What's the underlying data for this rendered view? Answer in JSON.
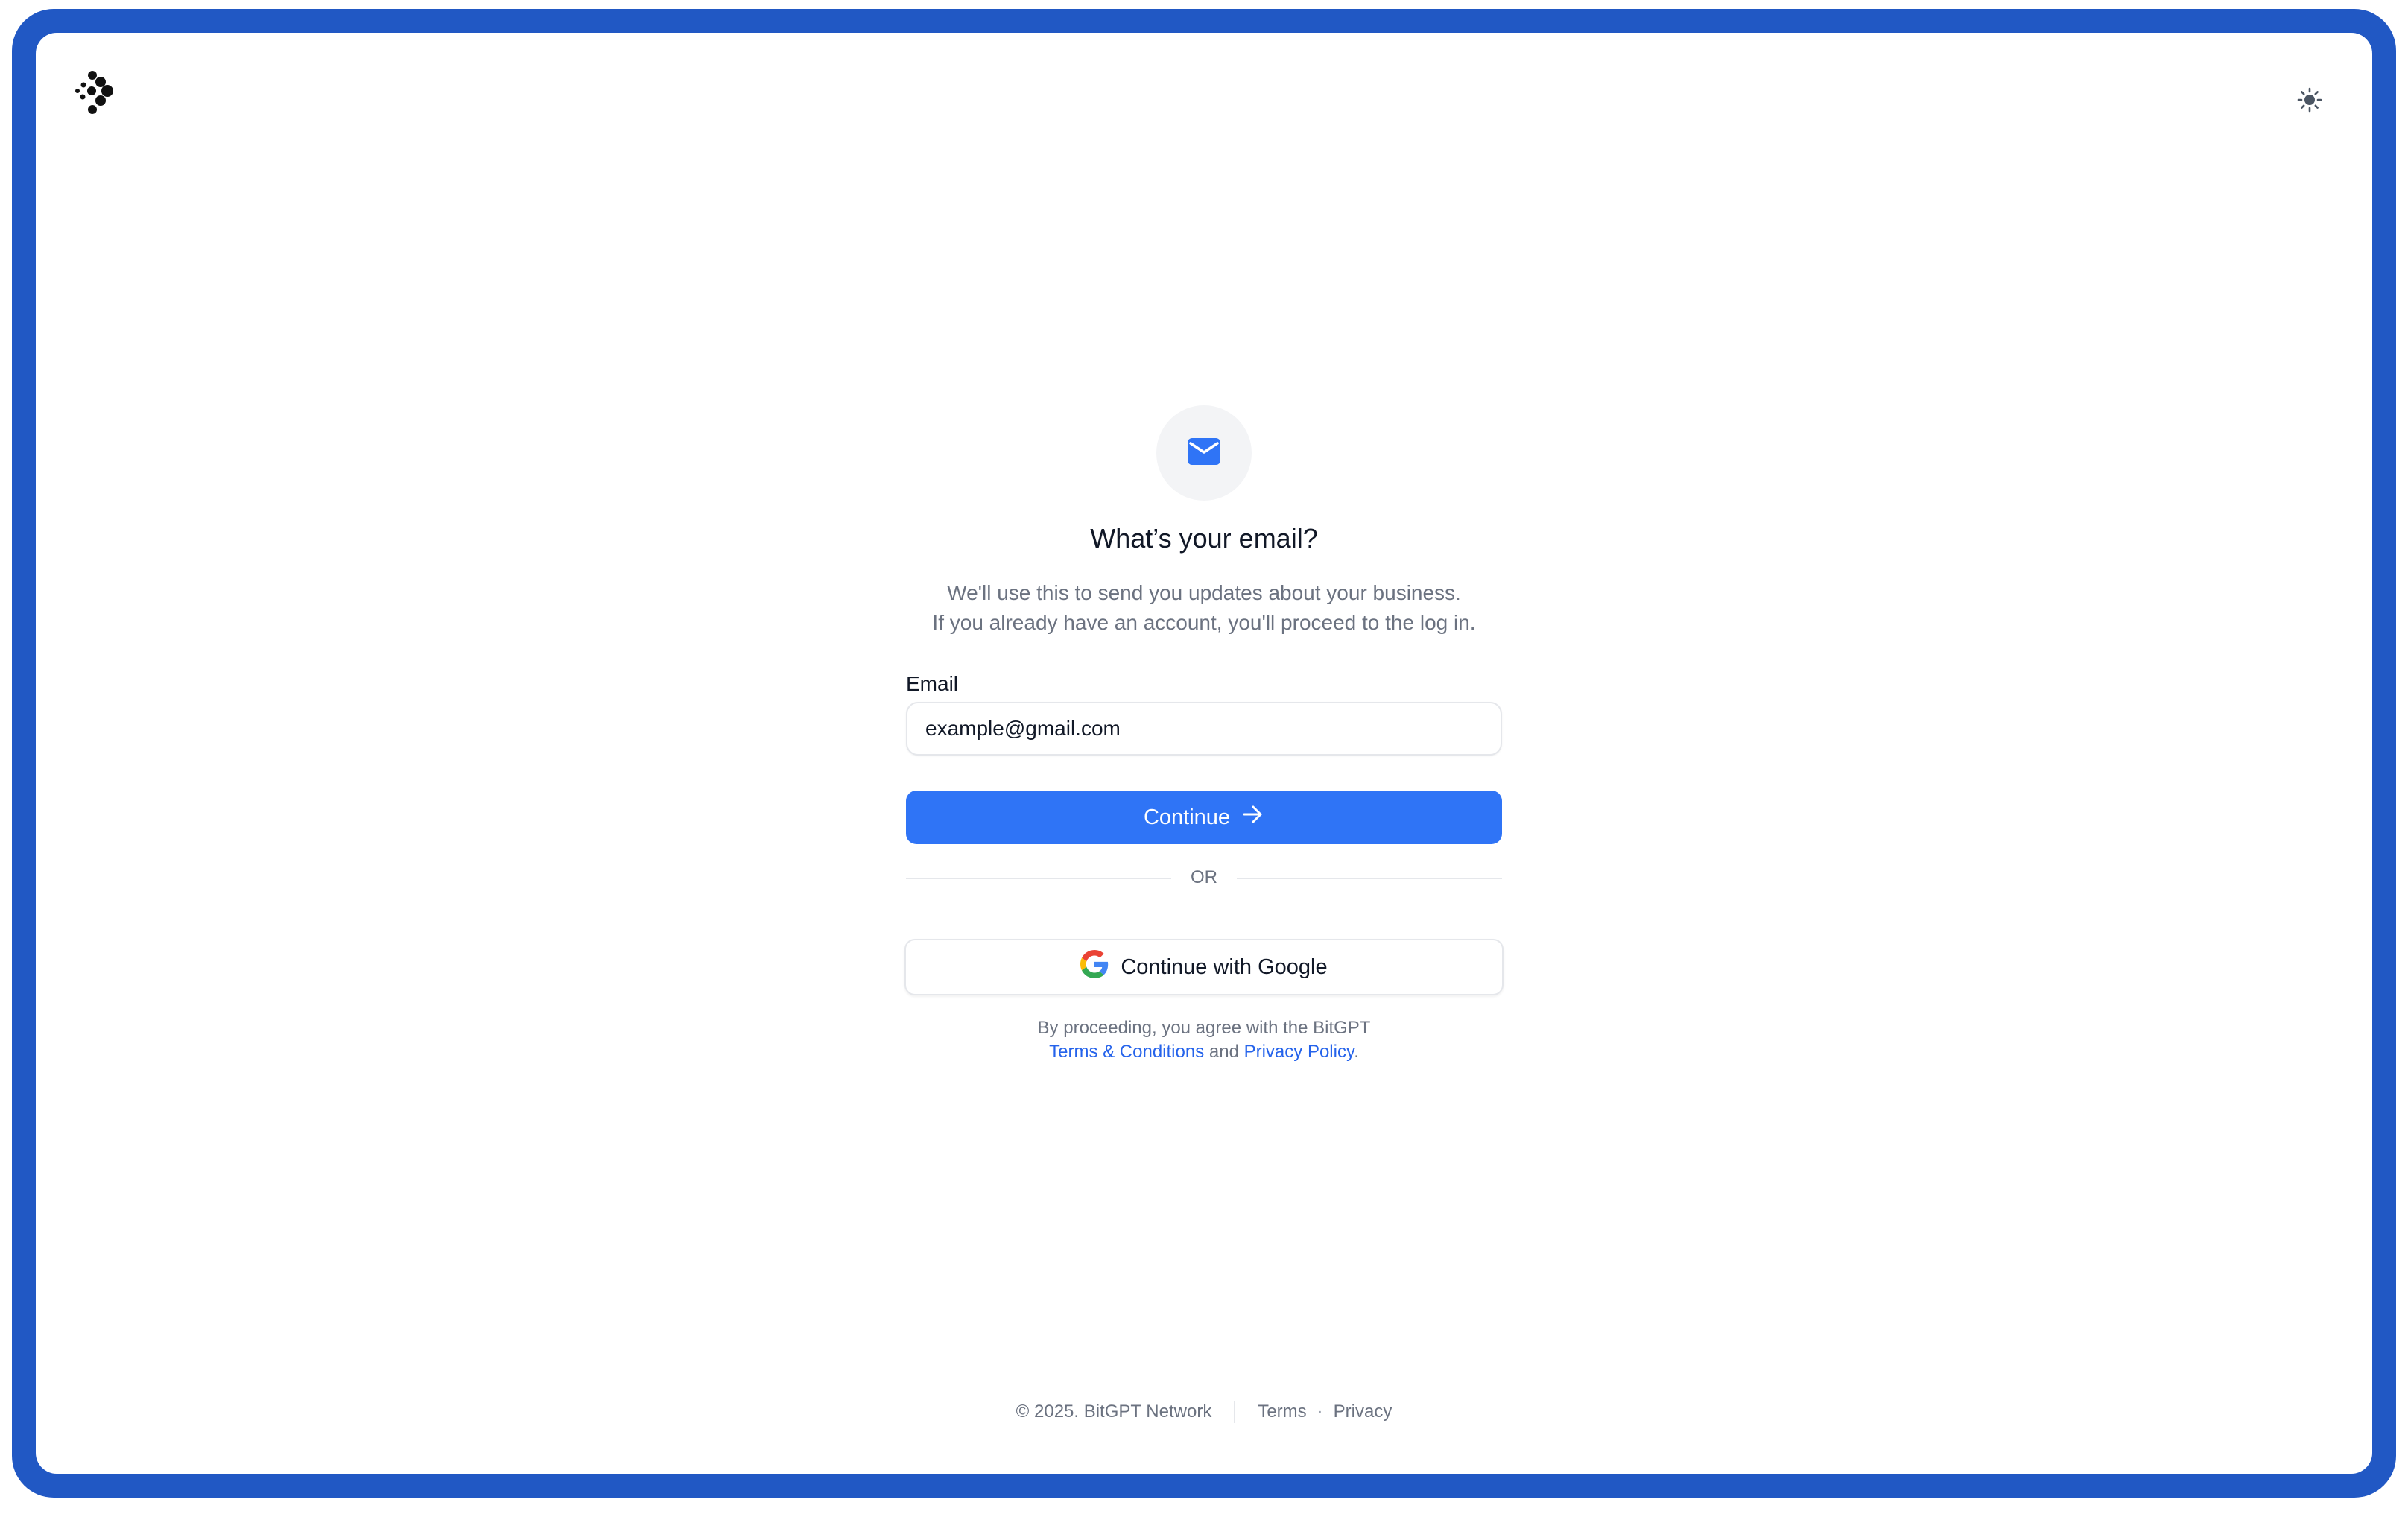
{
  "header": {
    "logo_icon": "bitgpt-logo-icon",
    "theme_toggle_icon": "sun-icon"
  },
  "form": {
    "icon": "mail-icon",
    "title": "What’s your email?",
    "subtitle_line1": "We'll use this to send you updates about your business.",
    "subtitle_line2": "If you already have an account, you'll proceed to the log in.",
    "email_label": "Email",
    "email_value": "example@gmail.com",
    "continue_label": "Continue",
    "or_label": "OR",
    "google_label": "Continue with Google",
    "legal_prefix": "By proceeding, you agree with the BitGPT",
    "terms_link": "Terms & Conditions",
    "legal_and": "and",
    "privacy_link": "Privacy Policy",
    "legal_suffix": "."
  },
  "footer": {
    "copyright": "© 2025. BitGPT Network",
    "terms": "Terms",
    "dot": "·",
    "privacy": "Privacy"
  },
  "colors": {
    "frame": "#2158c4",
    "primary": "#2f74f6",
    "link": "#2563eb",
    "muted_text": "#6b7280",
    "text": "#111827"
  }
}
